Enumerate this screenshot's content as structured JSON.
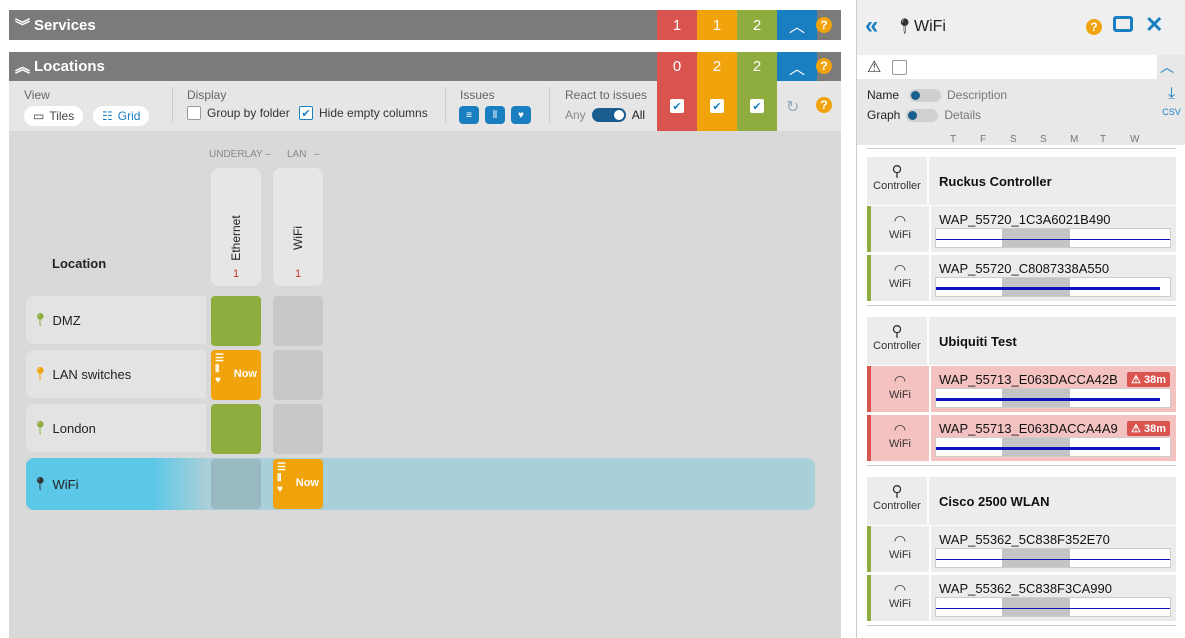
{
  "services": {
    "title": "Services",
    "counts": [
      "1",
      "1",
      "2"
    ]
  },
  "locations": {
    "title": "Locations",
    "counts": [
      "0",
      "2",
      "2"
    ]
  },
  "toolbar": {
    "view_label": "View",
    "tiles_label": "Tiles",
    "grid_label": "Grid",
    "display_label": "Display",
    "group_by_folder": "Group by folder",
    "hide_empty_columns": "Hide empty columns",
    "issues_label": "Issues",
    "react_label": "React to issues",
    "react_any": "Any",
    "react_all": "All"
  },
  "help_glyph": "?",
  "grid": {
    "group_underlay": "UNDERLAY",
    "group_lan": "LAN",
    "location_header": "Location",
    "columns": [
      {
        "label": "Ethernet",
        "count": "1"
      },
      {
        "label": "WiFi",
        "count": "1"
      }
    ],
    "rows": [
      {
        "label": "DMZ"
      },
      {
        "label": "LAN switches",
        "status": "Now"
      },
      {
        "label": "London"
      },
      {
        "label": "WiFi",
        "status": "Now"
      }
    ]
  },
  "side": {
    "title": "WiFi",
    "filter": {
      "name": "Name",
      "description": "Description",
      "graph": "Graph",
      "details": "Details",
      "csv": "CSV"
    },
    "days": [
      "T",
      "F",
      "S",
      "S",
      "M",
      "T",
      "W"
    ],
    "controller_label": "Controller",
    "wifi_label": "WiFi",
    "groups": [
      {
        "name": "Ruckus Controller",
        "devices": [
          {
            "name": "WAP_55720_1C3A6021B490",
            "alert": ""
          },
          {
            "name": "WAP_55720_C8087338A550",
            "alert": ""
          }
        ]
      },
      {
        "name": "Ubiquiti Test",
        "devices": [
          {
            "name": "WAP_55713_E063DACCA42B",
            "alert": "38m"
          },
          {
            "name": "WAP_55713_E063DACCA4A9",
            "alert": "38m"
          }
        ]
      },
      {
        "name": "Cisco 2500 WLAN",
        "devices": [
          {
            "name": "WAP_55362_5C838F352E70",
            "alert": ""
          },
          {
            "name": "WAP_55362_5C838F3CA990",
            "alert": ""
          }
        ]
      }
    ]
  },
  "colors": {
    "red": "#d9534f",
    "yellow": "#f0a30a",
    "green": "#8fac3e",
    "blue": "#1a7fc1"
  }
}
